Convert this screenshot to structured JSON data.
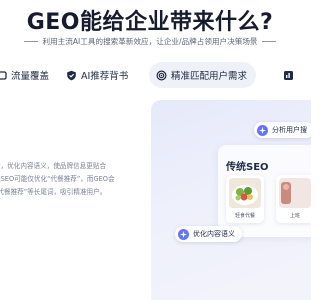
{
  "hero": {
    "title": "GEO能给企业带来什么?",
    "subtitle": "利用主流AI工具的搜索革新效应，让企业/品牌占领用户决策场景"
  },
  "tabs": [
    {
      "label": "流量覆盖",
      "icon": "traffic-icon",
      "active": false
    },
    {
      "label": "AI推荐背书",
      "icon": "shield-icon",
      "active": false
    },
    {
      "label": "精准匹配用户需求",
      "icon": "target-icon",
      "active": true
    },
    {
      "label": "",
      "icon": "chart-icon",
      "active": false
    }
  ],
  "content": {
    "lines": [
      "行，优化内容语义，使品牌信息更贴合",
      "统SEO可能仅优化“代餐推荐”，而GEO会",
      "“代餐推荐”等长尾词，吸引精准用户。"
    ]
  },
  "illustration": {
    "analyze_pill": "分析用户搜",
    "panel_title": "传统SEO",
    "food_label_1": "轻食代餐",
    "food_label_2": "上班",
    "optimize_pill": "优化内容语义"
  },
  "colors": {
    "accent": "#6a6ff5",
    "title": "#161c2d",
    "muted_text": "#7a8296",
    "active_tab_bg": "#eef1f7"
  }
}
